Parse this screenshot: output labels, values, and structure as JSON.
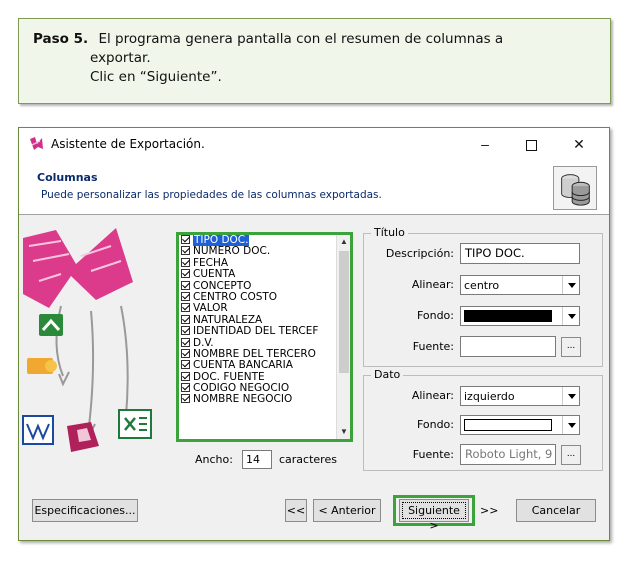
{
  "note": {
    "step_label": "Paso 5.",
    "line1": "El programa genera pantalla con el resumen de columnas a",
    "line2": "exportar.",
    "line3": "Clic en “Siguiente”."
  },
  "window": {
    "title": "Asistente de Exportación.",
    "controls": {
      "minimize": "–",
      "close": "✕"
    }
  },
  "header": {
    "title": "Columnas",
    "subtitle": "Puede personalizar las propiedades de las columnas exportadas."
  },
  "columns": {
    "items": [
      {
        "label": "TIPO DOC.",
        "checked": true,
        "selected": true
      },
      {
        "label": "NUMERO DOC.",
        "checked": true
      },
      {
        "label": "FECHA",
        "checked": true
      },
      {
        "label": "CUENTA",
        "checked": true
      },
      {
        "label": "CONCEPTO",
        "checked": true
      },
      {
        "label": "CENTRO COSTO",
        "checked": true
      },
      {
        "label": "VALOR",
        "checked": true
      },
      {
        "label": "NATURALEZA",
        "checked": true
      },
      {
        "label": "IDENTIDAD DEL TERCEF",
        "checked": true
      },
      {
        "label": "D.V.",
        "checked": true
      },
      {
        "label": "NOMBRE DEL TERCERO",
        "checked": true
      },
      {
        "label": "CUENTA BANCARIA",
        "checked": true
      },
      {
        "label": "DOC. FUENTE",
        "checked": true
      },
      {
        "label": "CODIGO NEGOCIO",
        "checked": true
      },
      {
        "label": "NOMBRE NEGOCIO",
        "checked": true
      }
    ],
    "ancho_label": "Ancho:",
    "ancho_value": "14",
    "ancho_unit": "caracteres"
  },
  "titulo": {
    "legend": "Título",
    "descripcion_label": "Descripción:",
    "descripcion_value": "TIPO DOC.",
    "alinear_label": "Alinear:",
    "alinear_value": "centro",
    "fondo_label": "Fondo:",
    "fondo_color": "#000000",
    "fuente_label": "Fuente:",
    "fuente_value": "",
    "fuente_button": "..."
  },
  "dato": {
    "legend": "Dato",
    "alinear_label": "Alinear:",
    "alinear_value": "izquierdo",
    "fondo_label": "Fondo:",
    "fondo_color": "#ffffff",
    "fuente_label": "Fuente:",
    "fuente_value": "Roboto Light, 9",
    "fuente_button": "..."
  },
  "buttons": {
    "especificaciones": "Especificaciones...",
    "first": "<<",
    "prev": "< Anterior",
    "next": "Siguiente >",
    "last": ">>",
    "cancel": "Cancelar"
  },
  "colors": {
    "highlight": "#3aa43a",
    "selection": "#1e60d8",
    "header_text": "#0a2a6a"
  }
}
